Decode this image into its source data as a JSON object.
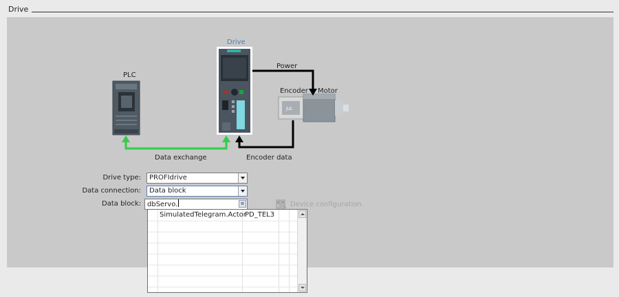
{
  "section": {
    "title": "Drive"
  },
  "diagram": {
    "plc_label": "PLC",
    "drive_label": "Drive",
    "power_label": "Power",
    "encoder_label": "Encoder",
    "motor_label": "Motor",
    "data_exchange_label": "Data exchange",
    "encoder_data_label": "Encoder data",
    "colors": {
      "data_exchange_arrow": "#33cc4a",
      "power_arrow": "#000000",
      "drive_label": "#4a7fc0",
      "panel_bg": "#c9c9c9"
    }
  },
  "form": {
    "drive_type": {
      "label": "Drive type:",
      "value": "PROFIdrive"
    },
    "data_connection": {
      "label": "Data connection:",
      "value": "Data block"
    },
    "data_block": {
      "label": "Data block:",
      "value": "dbServo."
    }
  },
  "device_configuration": {
    "label": "Device configuration",
    "icon": "device-config-icon",
    "enabled": false
  },
  "dropdown": {
    "rows": [
      {
        "name": "SimulatedTelegram.Actor",
        "type": "PD_TEL3"
      }
    ]
  }
}
